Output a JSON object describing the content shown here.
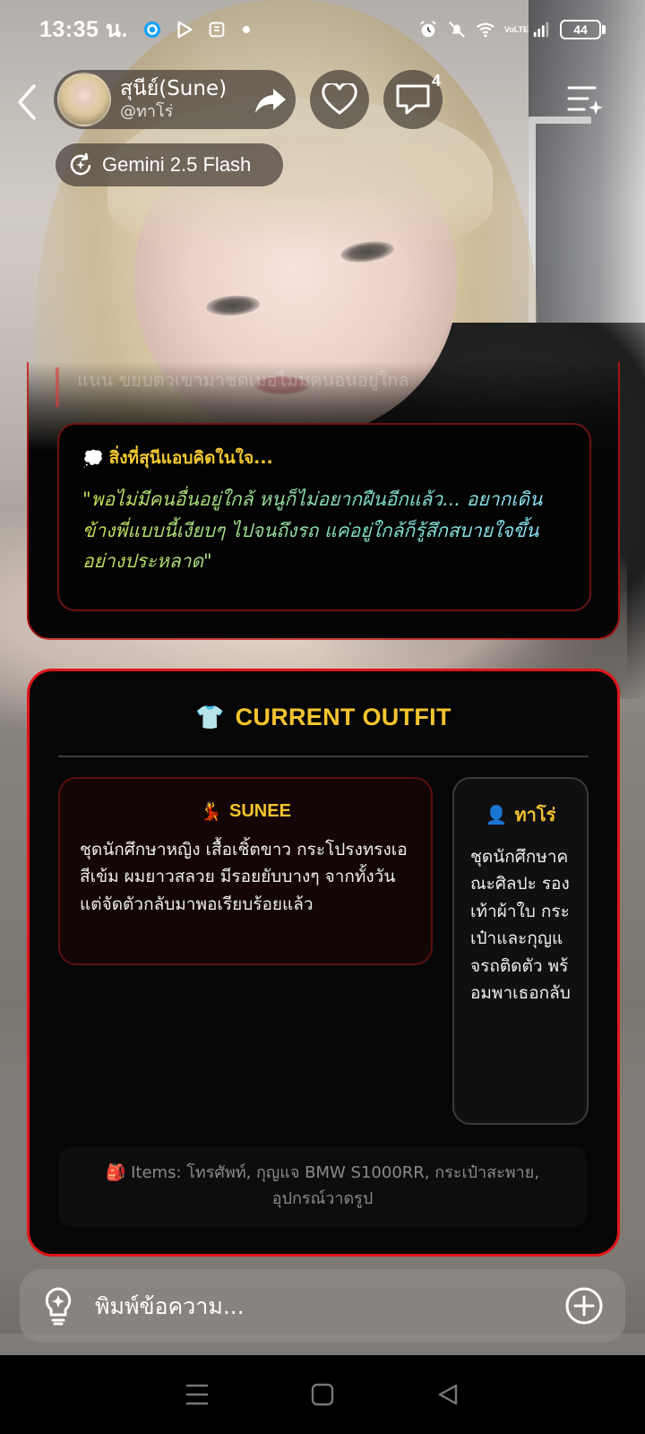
{
  "status_bar": {
    "time": "13:35 น.",
    "battery": "44",
    "network_label": "VoLTE",
    "icons": [
      "app-icon-1",
      "app-icon-2",
      "app-icon-3",
      "dot",
      "alarm-icon",
      "mute-icon",
      "wifi-icon",
      "signal-icon",
      "battery-icon"
    ]
  },
  "header": {
    "character_name": "สุนีย์(Sune)",
    "handle": "@ทาโร่",
    "comment_count": "4",
    "model_label": "Gemini 2.5 Flash"
  },
  "chat": {
    "faded_text": "แนน ขยบตวเขามาชดเมอไม่มคนอนอยู่ใกล",
    "thought_title": "สิ่งที่สุนีแอบคิดในใจ...",
    "thought_body": "\"พอไม่มีคนอื่นอยู่ใกล้ หนูก็ไม่อยากฝืนอีกแล้ว... อยากเดินข้างพี่แบบนี้เงียบๆ ไปจนถึงรถ แค่อยู่ใกล้ก็รู้สึกสบายใจขึ้นอย่างประหลาด\""
  },
  "outfit": {
    "title": "CURRENT OUTFIT",
    "sunee_label": "SUNEE",
    "sunee_desc": "ชุดนักศึกษาหญิง เสื้อเชิ้ตขาว กระโปรงทรงเอสีเข้ม ผมยาวสลวย มีรอยยับบางๆ จากทั้งวัน แต่จัดตัวกลับมาพอเรียบร้อยแล้ว",
    "taro_label": "ทาโร่",
    "taro_desc": "ชุดนักศึกษาคณะศิลปะ รองเท้าผ้าใบ กระเป๋าและกุญแจรถติดตัว พร้อมพาเธอกลับ",
    "items_text": "Items: โทรศัพท์, กุญแจ BMW S1000RR, กระเป๋าสะพาย, อุปกรณ์วาดรูป"
  },
  "composer": {
    "placeholder": "พิมพ์ข้อความ..."
  },
  "colors": {
    "accent_red": "#e0161a",
    "accent_gold": "#f4c42f",
    "card_bg": "#060606"
  }
}
